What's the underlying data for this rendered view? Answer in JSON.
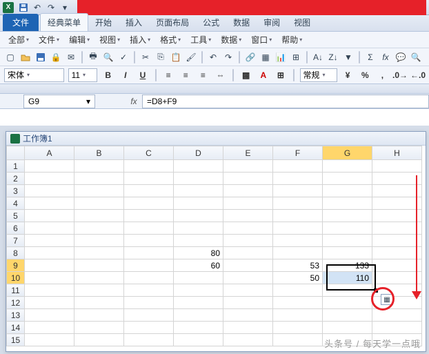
{
  "qat": {
    "excel_letter": "X"
  },
  "tabs": {
    "file": "文件",
    "classic": "经典菜单",
    "home": "开始",
    "insert": "插入",
    "layout": "页面布局",
    "formulas": "公式",
    "data": "数据",
    "review": "审阅",
    "view": "视图"
  },
  "menus": {
    "all": "全部",
    "file": "文件",
    "edit": "编辑",
    "view": "视图",
    "insert": "插入",
    "format": "格式",
    "tools": "工具",
    "data": "数据",
    "window": "窗口",
    "help": "帮助"
  },
  "format": {
    "font_name": "宋体",
    "font_size": "11",
    "number_format": "常规"
  },
  "namebox": {
    "cell_ref": "G9"
  },
  "formula_bar": {
    "fx": "fx",
    "value": "=D8+F9"
  },
  "workbook": {
    "title": "工作簿1"
  },
  "columns": [
    "A",
    "B",
    "C",
    "D",
    "E",
    "F",
    "G",
    "H"
  ],
  "selected_col": "G",
  "selected_rows": [
    9,
    10
  ],
  "cells": {
    "D8": "80",
    "D9": "60",
    "F9": "53",
    "F10": "50",
    "G9": "133",
    "G10": "110"
  },
  "watermark": "头条号 / 每天学一点哦"
}
